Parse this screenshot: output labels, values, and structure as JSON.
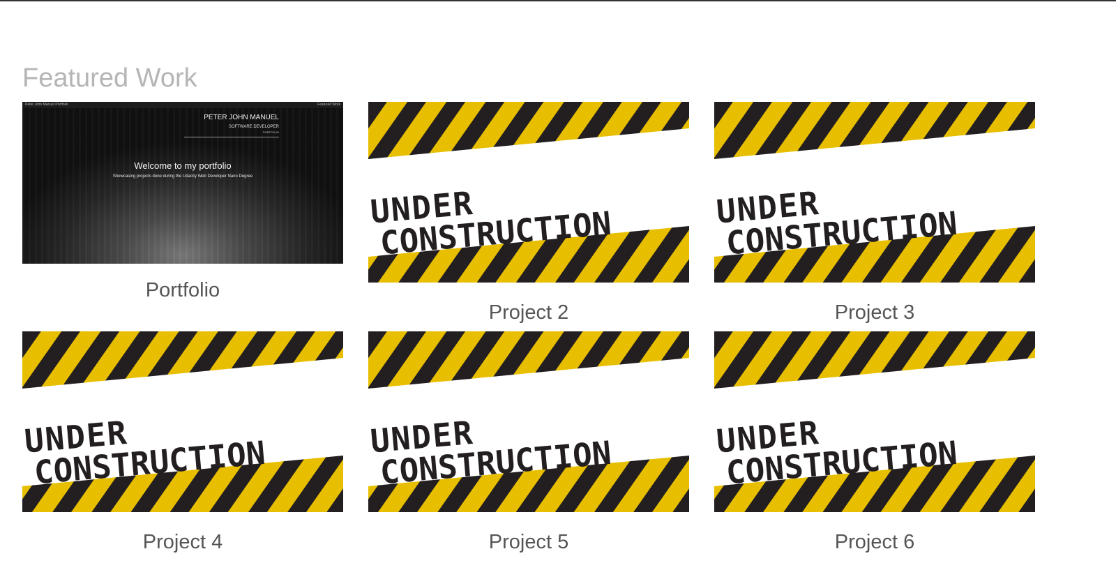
{
  "section": {
    "title": "Featured Work"
  },
  "colors": {
    "title": "#b5b5b5",
    "caption": "#555555",
    "stripe_yellow": "#e8bf00",
    "stripe_black": "#231f20"
  },
  "projects": [
    {
      "caption": "Portfolio",
      "thumbnail": {
        "nav_left": "Peter John Manuel Portfolio",
        "nav_right": "Featured Work",
        "name": "PETER JOHN MANUEL",
        "role": "SOFTWARE DEVELOPER",
        "sub": "PORTFOLIO",
        "welcome": "Welcome to my portfolio",
        "tagline": "Showcasing projects done during the Udacity Web Developer Nano Degree"
      }
    },
    {
      "caption": "Project 2",
      "sign": {
        "line1": "UNDER",
        "line2": "CONSTRUCTION"
      }
    },
    {
      "caption": "Project 3",
      "sign": {
        "line1": "UNDER",
        "line2": "CONSTRUCTION"
      }
    },
    {
      "caption": "Project 4",
      "sign": {
        "line1": "UNDER",
        "line2": "CONSTRUCTION"
      }
    },
    {
      "caption": "Project 5",
      "sign": {
        "line1": "UNDER",
        "line2": "CONSTRUCTION"
      }
    },
    {
      "caption": "Project 6",
      "sign": {
        "line1": "UNDER",
        "line2": "CONSTRUCTION"
      }
    }
  ]
}
